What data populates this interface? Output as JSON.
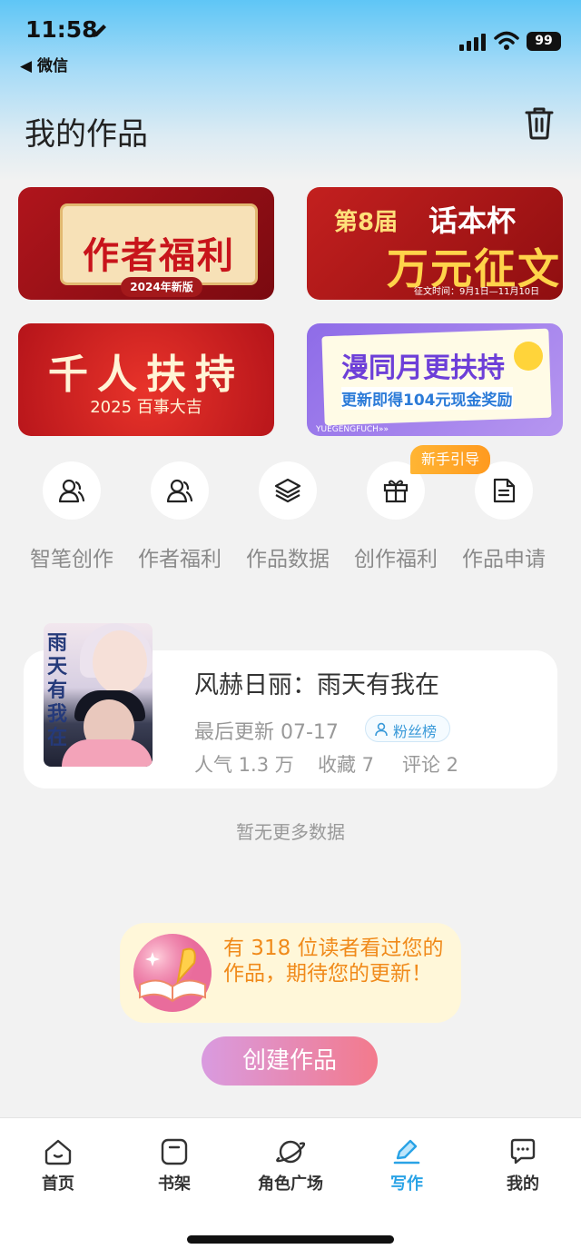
{
  "status": {
    "time": "11:58",
    "back_app": "◀ 微信",
    "battery": "99"
  },
  "header": {
    "title": "我的作品"
  },
  "banners": [
    {
      "title": "作者福利",
      "subtitle": "2024年新版"
    },
    {
      "prefix": "第8届",
      "title": "话本杯",
      "main": "万元征文",
      "footer": "征文时间：9月1日—11月10日"
    },
    {
      "title": "千人扶持",
      "subtitle": "2025 百事大吉"
    },
    {
      "title": "漫同月更扶持",
      "subtitle": "更新即得104元现金奖励",
      "footer": "YUEGENGFUCH»»"
    }
  ],
  "shortcuts": [
    {
      "label": "智笔创作",
      "icon": "user-pen-icon"
    },
    {
      "label": "作者福利",
      "icon": "users-icon"
    },
    {
      "label": "作品数据",
      "icon": "layers-icon"
    },
    {
      "label": "创作福利",
      "icon": "gift-icon"
    },
    {
      "label": "作品申请",
      "icon": "document-icon"
    }
  ],
  "new_tag": "新手引导",
  "work": {
    "cover_title": "雨天有我在",
    "title": "风赫日丽：雨天有我在",
    "last_update": "最后更新 07-17",
    "fans_badge": "粉丝榜",
    "popularity": "人气 1.3 万",
    "favorites": "收藏 7",
    "comments": "评论 2"
  },
  "no_more": "暂无更多数据",
  "reader_tip": "有 318 位读者看过您的作品，期待您的更新！",
  "create_button": "创建作品",
  "tabs": [
    {
      "label": "首页",
      "icon": "home-icon"
    },
    {
      "label": "书架",
      "icon": "bookshelf-icon"
    },
    {
      "label": "角色广场",
      "icon": "planet-icon"
    },
    {
      "label": "写作",
      "icon": "pen-icon",
      "active": true
    },
    {
      "label": "我的",
      "icon": "chat-bubble-icon"
    }
  ],
  "colors": {
    "accent": "#2aa3e6",
    "tip_text": "#f08a1a",
    "new_tag": "#ff9a1f"
  }
}
